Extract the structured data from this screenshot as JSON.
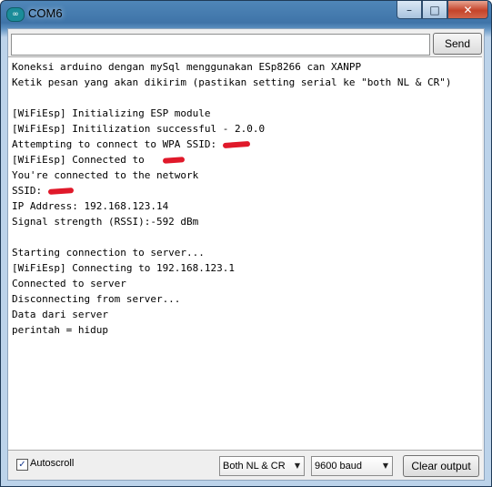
{
  "window": {
    "title": "COM6",
    "app_icon_glyph": "∞",
    "buttons": {
      "minimize": "–",
      "maximize": "□",
      "close": "✕"
    }
  },
  "send": {
    "input_value": "",
    "button_label": "Send"
  },
  "console": {
    "lines": [
      "Koneksi arduino dengan mySql menggunakan ESp8266 can XANPP",
      "Ketik pesan yang akan dikirim (pastikan setting serial ke \"both NL & CR\")",
      "",
      "[WiFiEsp] Initializing ESP module",
      "[WiFiEsp] Initilization successful - 2.0.0",
      "Attempting to connect to WPA SSID: ",
      "[WiFiEsp] Connected to",
      "You're connected to the network",
      "SSID: ",
      "IP Address: 192.168.123.14",
      "Signal strength (RSSI):-592 dBm",
      "",
      "Starting connection to server...",
      "[WiFiEsp] Connecting to 192.168.123.1",
      "Connected to server",
      "Disconnecting from server...",
      "Data dari server",
      "perintah = hidup"
    ]
  },
  "bottom": {
    "autoscroll_label": "Autoscroll",
    "autoscroll_checked": true,
    "checkmark": "✓",
    "line_ending": "Both NL & CR",
    "baud": "9600 baud",
    "dropdown_arrow": "▼",
    "clear_label": "Clear output"
  },
  "colors": {
    "redaction": "#e0192a",
    "titlebar": "#3f74a8"
  }
}
